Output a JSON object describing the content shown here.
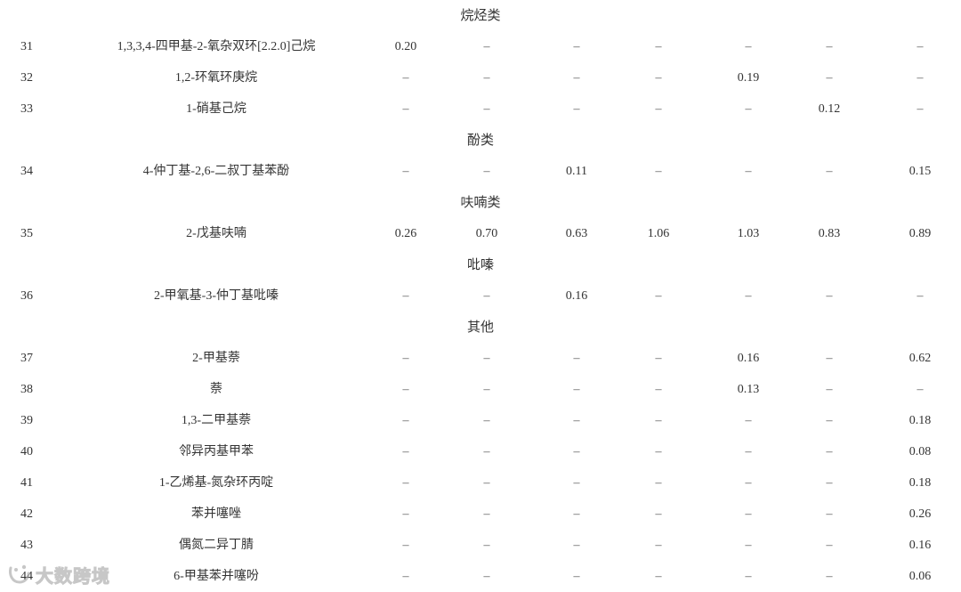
{
  "watermark": {
    "text": "大数跨境",
    "icon": "smile-logo-icon"
  },
  "rows": [
    {
      "type": "section",
      "label": "烷烃类"
    },
    {
      "type": "data",
      "no": "31",
      "name": "1,3,3,4-四甲基-2-氧杂双环[2.2.0]己烷",
      "values": [
        "0.20",
        "–",
        "–",
        "–",
        "–",
        "–",
        "–"
      ]
    },
    {
      "type": "data",
      "no": "32",
      "name": "1,2-环氧环庚烷",
      "values": [
        "–",
        "–",
        "–",
        "–",
        "0.19",
        "–",
        "–"
      ]
    },
    {
      "type": "data",
      "no": "33",
      "name": "1-硝基己烷",
      "values": [
        "–",
        "–",
        "–",
        "–",
        "–",
        "0.12",
        "–"
      ]
    },
    {
      "type": "section",
      "label": "酚类"
    },
    {
      "type": "data",
      "no": "34",
      "name": "4-仲丁基-2,6-二叔丁基苯酚",
      "values": [
        "–",
        "–",
        "0.11",
        "–",
        "–",
        "–",
        "0.15"
      ]
    },
    {
      "type": "section",
      "label": "呋喃类"
    },
    {
      "type": "data",
      "no": "35",
      "name": "2-戊基呋喃",
      "values": [
        "0.26",
        "0.70",
        "0.63",
        "1.06",
        "1.03",
        "0.83",
        "0.89"
      ]
    },
    {
      "type": "section",
      "label": "吡嗪"
    },
    {
      "type": "data",
      "no": "36",
      "name": "2-甲氧基-3-仲丁基吡嗪",
      "values": [
        "–",
        "–",
        "0.16",
        "–",
        "–",
        "–",
        "–"
      ]
    },
    {
      "type": "section",
      "label": "其他"
    },
    {
      "type": "data",
      "no": "37",
      "name": "2-甲基萘",
      "values": [
        "–",
        "–",
        "–",
        "–",
        "0.16",
        "–",
        "0.62"
      ]
    },
    {
      "type": "data",
      "no": "38",
      "name": "萘",
      "values": [
        "–",
        "–",
        "–",
        "–",
        "0.13",
        "–",
        "–"
      ]
    },
    {
      "type": "data",
      "no": "39",
      "name": "1,3-二甲基萘",
      "values": [
        "–",
        "–",
        "–",
        "–",
        "–",
        "–",
        "0.18"
      ]
    },
    {
      "type": "data",
      "no": "40",
      "name": "邻异丙基甲苯",
      "values": [
        "–",
        "–",
        "–",
        "–",
        "–",
        "–",
        "0.08"
      ]
    },
    {
      "type": "data",
      "no": "41",
      "name": "1-乙烯基-氮杂环丙啶",
      "values": [
        "–",
        "–",
        "–",
        "–",
        "–",
        "–",
        "0.18"
      ]
    },
    {
      "type": "data",
      "no": "42",
      "name": "苯并噻唑",
      "values": [
        "–",
        "–",
        "–",
        "–",
        "–",
        "–",
        "0.26"
      ]
    },
    {
      "type": "data",
      "no": "43",
      "name": "偶氮二异丁腈",
      "values": [
        "–",
        "–",
        "–",
        "–",
        "–",
        "–",
        "0.16"
      ]
    },
    {
      "type": "data",
      "no": "44",
      "name": "6-甲基苯并噻吩",
      "values": [
        "–",
        "–",
        "–",
        "–",
        "–",
        "–",
        "0.06"
      ]
    }
  ]
}
